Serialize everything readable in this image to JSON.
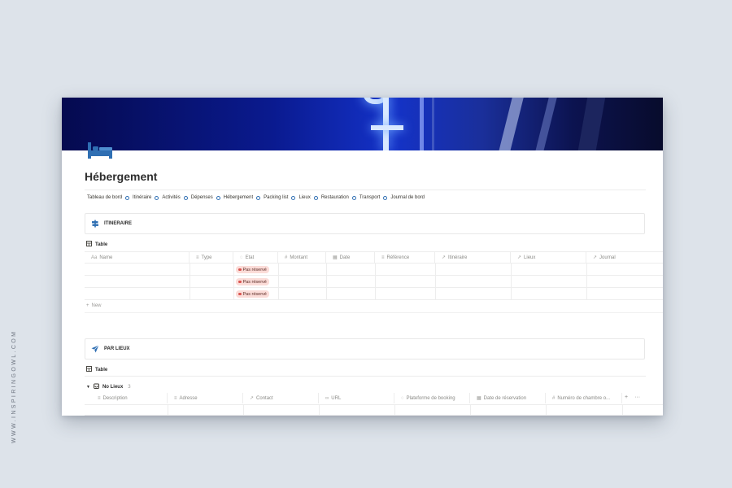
{
  "watermark": "WWW.INSPIRINGOWL.COM",
  "page": {
    "title": "Hébergement",
    "icon": "bed-icon",
    "accent": "#2f6fb3"
  },
  "breadcrumb": [
    "Tableau de bord",
    "Itinéraire",
    "Activités",
    "Dépenses",
    "Hébergement",
    "Packing list",
    "Lieux",
    "Restauration",
    "Transport",
    "Journal de bord"
  ],
  "section1": {
    "title": "ITINERAIRE",
    "icon": "signpost-icon",
    "view_label": "Table",
    "columns": [
      {
        "label": "Name",
        "icon": "Aa"
      },
      {
        "label": "Type",
        "icon": "≡"
      },
      {
        "label": "Etat",
        "icon": "◌"
      },
      {
        "label": "Montant",
        "icon": "#"
      },
      {
        "label": "Date",
        "icon": "▦"
      },
      {
        "label": "Référence",
        "icon": "≡"
      },
      {
        "label": "Itinéraire",
        "icon": "↗"
      },
      {
        "label": "Lieux",
        "icon": "↗"
      },
      {
        "label": "Journal",
        "icon": "↗"
      }
    ],
    "rows": [
      {
        "etat": "Pas réservé"
      },
      {
        "etat": "Pas réservé"
      },
      {
        "etat": "Pas réservé"
      }
    ],
    "new_label": "New",
    "status_color": "#fbdcd8"
  },
  "section2": {
    "title": "PAR LIEUX",
    "icon": "paper-plane-icon",
    "view_label": "Table",
    "group": {
      "name": "No Lieux",
      "count": "3"
    },
    "columns": [
      {
        "label": "Description",
        "icon": "≡"
      },
      {
        "label": "Adresse",
        "icon": "≡"
      },
      {
        "label": "Contact",
        "icon": "↗"
      },
      {
        "label": "URL",
        "icon": "∞"
      },
      {
        "label": "Plateforme de booking",
        "icon": "◌"
      },
      {
        "label": "Date de réservation",
        "icon": "▦"
      },
      {
        "label": "Numéro de chambre o...",
        "icon": "#"
      }
    ],
    "add_label": "+",
    "more_label": "···"
  }
}
